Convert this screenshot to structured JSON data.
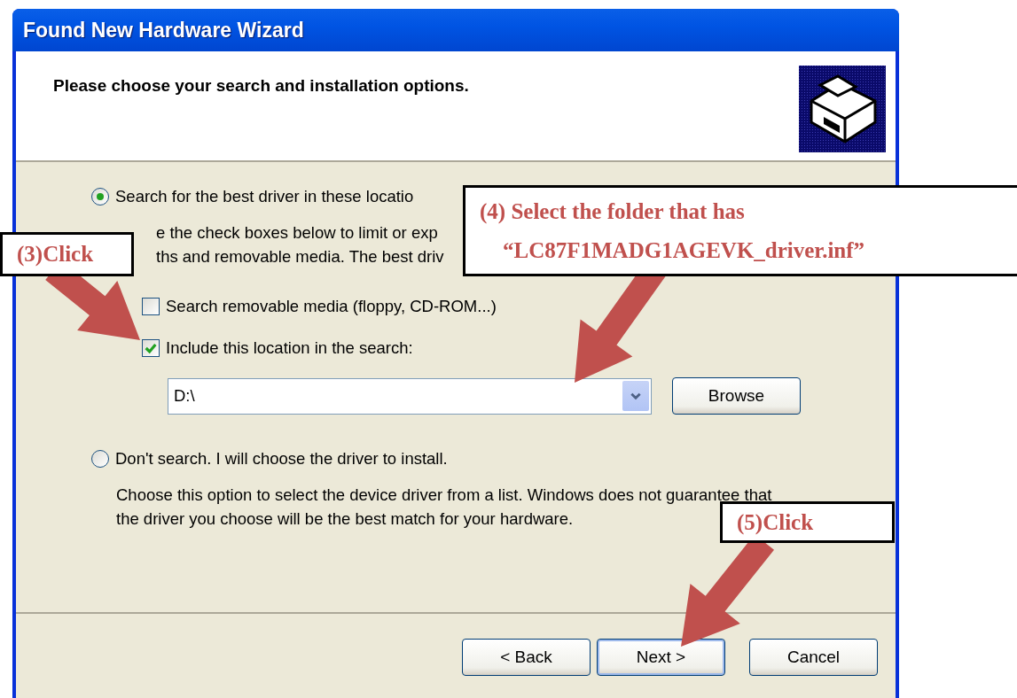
{
  "window": {
    "title": "Found New Hardware Wizard"
  },
  "header": {
    "heading": "Please choose your search and installation options."
  },
  "options": [
    {
      "label": "Search for the best driver in these locatio",
      "selected": true,
      "description": [
        "e the check boxes below to limit or exp",
        "ths and removable media. The best driv"
      ]
    },
    {
      "label": "Don't search. I will choose the driver to install.",
      "selected": false,
      "description": [
        "Choose this option to select the device driver from a list.  Windows does not guarantee that",
        "the driver you choose will be the best match for your hardware."
      ]
    }
  ],
  "checkboxes": [
    {
      "label": "Search removable media (floppy, CD-ROM...)",
      "checked": false
    },
    {
      "label": "Include this location in the search:",
      "checked": true
    }
  ],
  "location": {
    "value": "D:\\"
  },
  "browse_button": "Browse",
  "buttons": [
    {
      "label": "< Back",
      "default": false
    },
    {
      "label": "Next >",
      "default": true
    },
    {
      "label": "Cancel",
      "default": false
    }
  ],
  "annotations": [
    {
      "lines": [
        "(3)Click"
      ]
    },
    {
      "lines": [
        "(4) Select the folder that has",
        "“LC87F1MADG1AGEVK_driver.inf”"
      ]
    },
    {
      "lines": [
        "(5)Click"
      ]
    }
  ]
}
